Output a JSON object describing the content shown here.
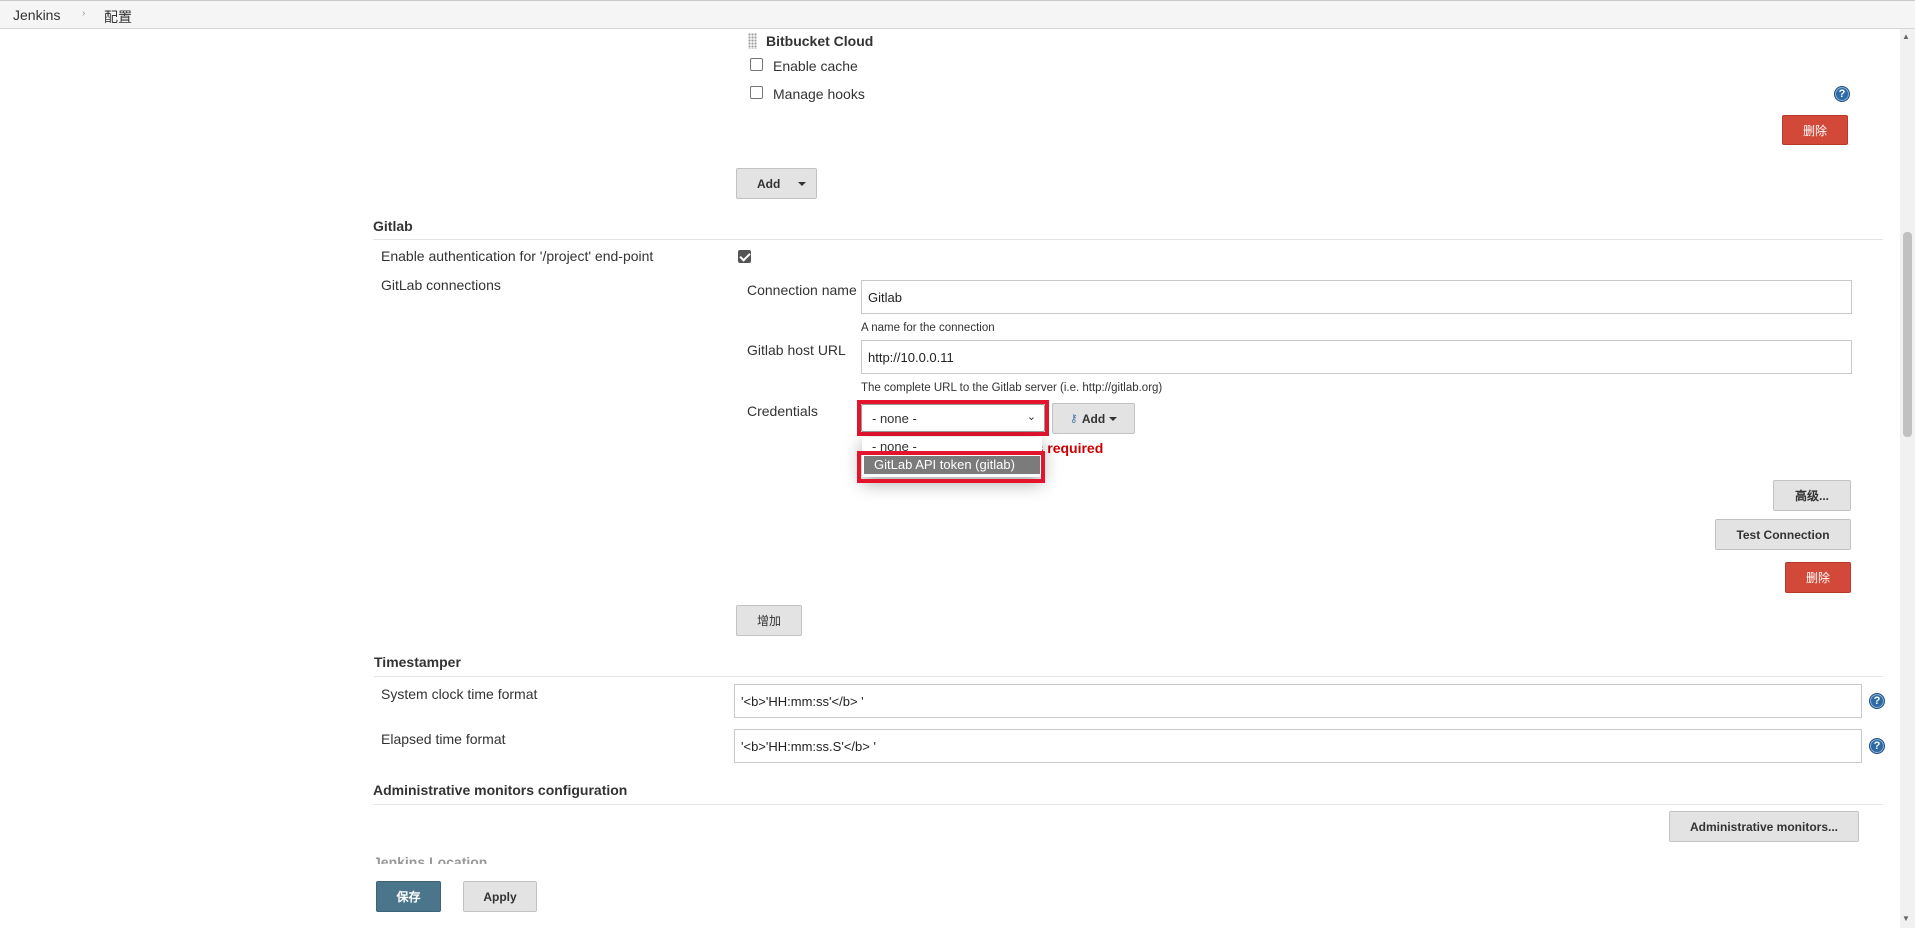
{
  "breadcrumb": {
    "home": "Jenkins",
    "current": "配置"
  },
  "bitbucket": {
    "title": "Bitbucket Cloud",
    "enable_cache": "Enable cache",
    "manage_hooks": "Manage hooks",
    "delete_label": "删除",
    "add_label": "Add"
  },
  "gitlab": {
    "section_title": "Gitlab",
    "enable_auth_label": "Enable authentication for '/project' end-point",
    "enable_auth_checked": true,
    "connections_label": "GitLab connections",
    "connection_name_label": "Connection name",
    "connection_name_value": "Gitlab",
    "connection_name_help": "A name for the connection",
    "host_url_label": "Gitlab host URL",
    "host_url_value": "http://10.0.0.11",
    "host_url_help": "The complete URL to the Gitlab server (i.e. http://gitlab.org)",
    "credentials_label": "Credentials",
    "credentials_selected": "- none -",
    "credentials_options": [
      "- none -",
      "GitLab API token (gitlab)"
    ],
    "credentials_add_label": "Add",
    "credentials_error": "ess required",
    "advanced_label": "高级...",
    "test_connection_label": "Test Connection",
    "delete_label": "删除",
    "add_connection_label": "增加"
  },
  "timestamper": {
    "section_title": "Timestamper",
    "system_clock_label": "System clock time format",
    "system_clock_value": "'<b>'HH:mm:ss'</b> '",
    "elapsed_label": "Elapsed time format",
    "elapsed_value": "'<b>'HH:mm:ss.S'</b> '"
  },
  "admin_monitors": {
    "section_title": "Administrative monitors configuration",
    "button_label": "Administrative monitors..."
  },
  "jenkins_location": {
    "section_title": "Jenkins Location"
  },
  "footer": {
    "save_label": "保存",
    "apply_label": "Apply"
  },
  "colors": {
    "danger": "#d24939",
    "primary": "#4b758b",
    "highlight": "#e4142d",
    "error_text": "#cc0000",
    "help_icon": "#2d6aa6"
  }
}
